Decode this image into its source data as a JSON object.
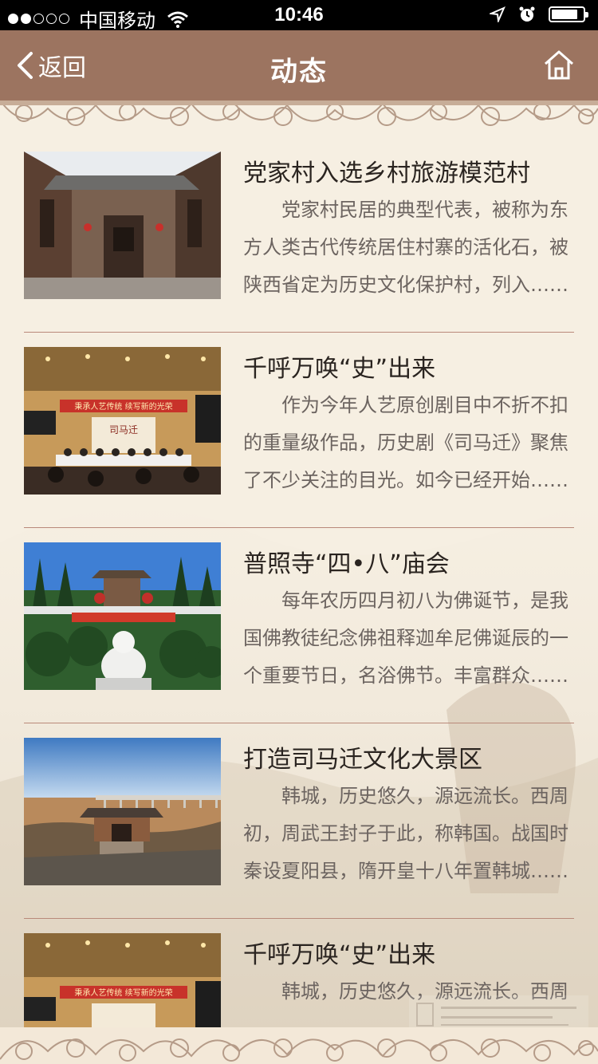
{
  "status_bar": {
    "carrier": "中国移动",
    "time": "10:46",
    "battery_level": 0.85
  },
  "nav": {
    "back_label": "返回",
    "title": "动态",
    "home_icon": "home-icon"
  },
  "news": [
    {
      "title": "党家村入选乡村旅游模范村",
      "summary": "党家村民居的典型代表，被称为东方人类古代传统居住村寨的活化石，被陕西省定为历史文化保护村，列入……",
      "image": "courtyard-photo"
    },
    {
      "title": "千呼万唤“史”出来",
      "summary": "作为今年人艺原创剧目中不折不扣的重量级作品，历史剧《司马迁》聚焦了不少关注的目光。如今已经开始……",
      "image": "press-conference-photo"
    },
    {
      "title": "普照寺“四•八”庙会",
      "summary": "每年农历四月初八为佛诞节，是我国佛教徒纪念佛祖释迦牟尼佛诞辰的一个重要节日，名浴佛节。丰富群众……",
      "image": "temple-photo"
    },
    {
      "title": "打造司马迁文化大景区",
      "summary": "韩城，历史悠久，源远流长。西周初，周武王封子于此，称韩国。战国时秦设夏阳县，隋开皇十八年置韩城……",
      "image": "landscape-gate-photo"
    },
    {
      "title": "千呼万唤“史”出来",
      "summary": "韩城，历史悠久，源远流长。西周",
      "image": "press-conference-photo"
    }
  ],
  "colors": {
    "nav_bg": "#9c7460",
    "page_bg": "#f6efe2",
    "divider": "#b9897a",
    "title_text": "#2a2420",
    "summary_text": "#6c6460"
  }
}
